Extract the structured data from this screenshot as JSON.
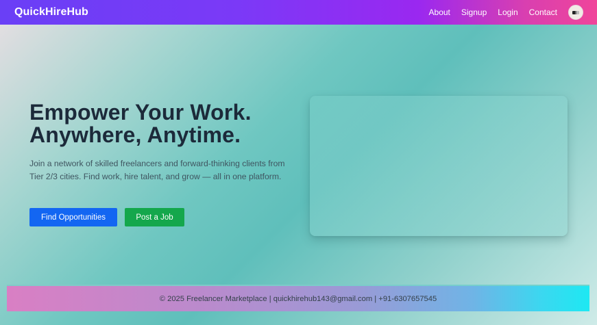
{
  "navbar": {
    "brand": "QuickHireHub",
    "links": [
      "About",
      "Signup",
      "Login",
      "Contact"
    ],
    "avatar_icon": "user-avatar-icon"
  },
  "hero": {
    "title_line1": "Empower Your Work.",
    "title_line2": "Anywhere, Anytime.",
    "description": "Join a network of skilled freelancers and forward-thinking clients from Tier 2/3 cities. Find work, hire talent, and grow — all in one platform.",
    "primary_button": "Find Opportunities",
    "secondary_button": "Post a Job"
  },
  "footer": {
    "text": "© 2025 Freelancer Marketplace | quickhirehub143@gmail.com | +91-6307657545"
  },
  "colors": {
    "navbar_start": "#6a3ff6",
    "navbar_end": "#f0459a",
    "primary_button": "#1366f2",
    "secondary_button": "#14a74c",
    "title_text": "#1c2a3a"
  }
}
